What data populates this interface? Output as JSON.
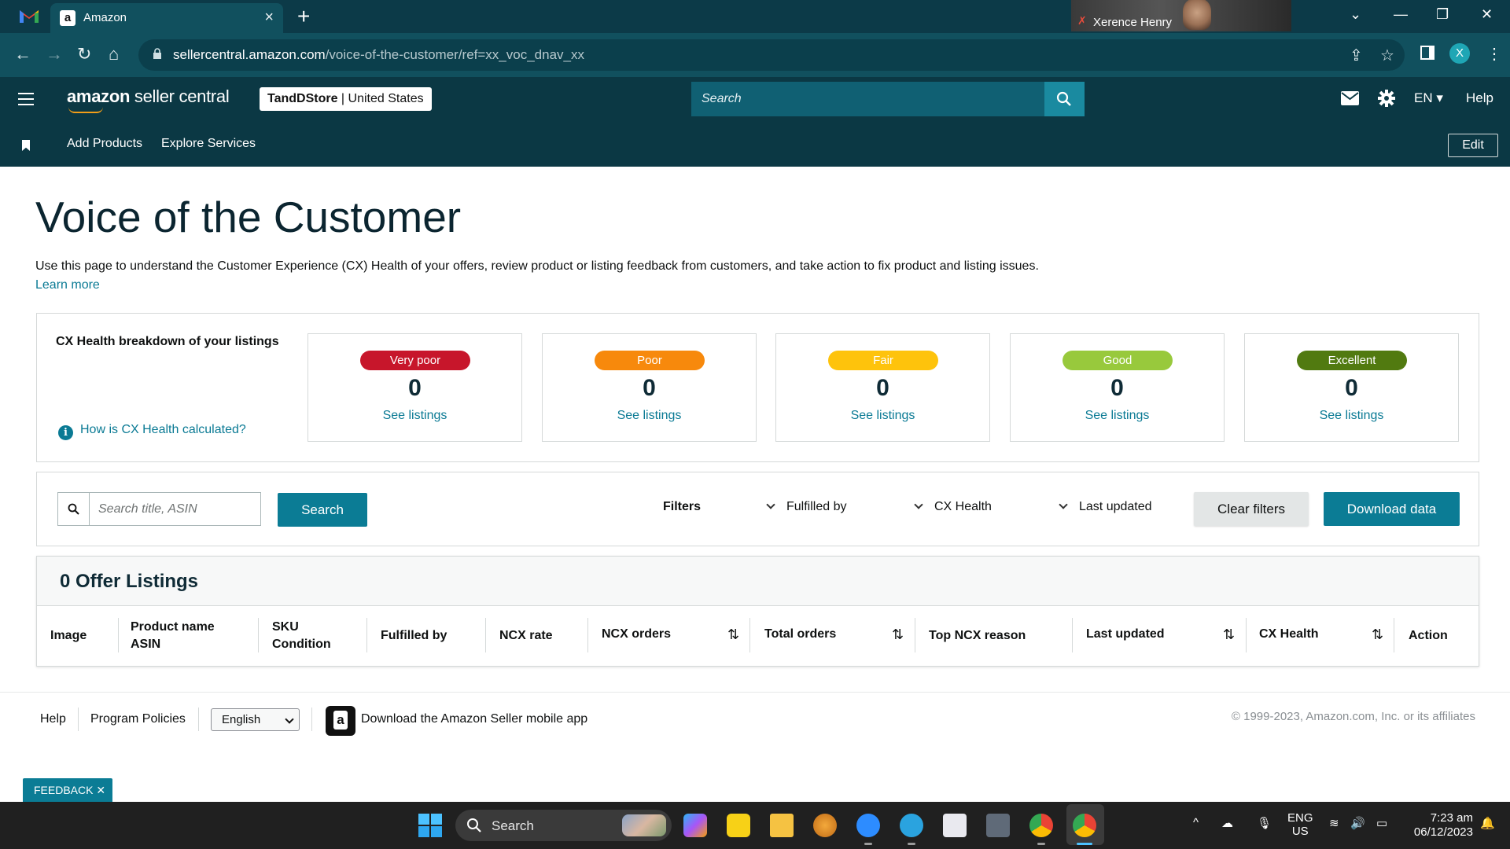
{
  "browser": {
    "tab_title": "Amazon",
    "url_domain": "sellercentral.amazon.com",
    "url_path": "/voice-of-the-customer/ref=xx_voc_dnav_xx",
    "profile_initial": "X",
    "meeting_participant": "Xerence Henry"
  },
  "header": {
    "logo_brand": "amazon",
    "logo_product": "seller central",
    "store_name": "TandDStore",
    "store_region": "United States",
    "search_placeholder": "Search",
    "language": "EN",
    "help": "Help"
  },
  "subnav": {
    "links": [
      "Add Products",
      "Explore Services"
    ],
    "edit": "Edit"
  },
  "page": {
    "title": "Voice of the Customer",
    "intro": "Use this page to understand the Customer Experience (CX) Health of your offers, review product or listing feedback from customers, and take action to fix product and listing issues.",
    "learn_more": "Learn more"
  },
  "breakdown": {
    "title": "CX Health breakdown of your listings",
    "info_link": "How is CX Health calculated?",
    "tiles": [
      {
        "label": "Very poor",
        "count": "0",
        "link": "See listings",
        "color": "#c7162b"
      },
      {
        "label": "Poor",
        "count": "0",
        "link": "See listings",
        "color": "#f7890c"
      },
      {
        "label": "Fair",
        "count": "0",
        "link": "See listings",
        "color": "#fec30c"
      },
      {
        "label": "Good",
        "count": "0",
        "link": "See listings",
        "color": "#98c93c"
      },
      {
        "label": "Excellent",
        "count": "0",
        "link": "See listings",
        "color": "#517a10"
      }
    ]
  },
  "filter_bar": {
    "search_placeholder": "Search title, ASIN",
    "search_button": "Search",
    "filters_label": "Filters",
    "filters": [
      "Fulfilled by",
      "CX Health",
      "Last updated"
    ],
    "clear_filters": "Clear filters",
    "download": "Download data"
  },
  "listings": {
    "title": "0 Offer Listings",
    "columns": {
      "image": "Image",
      "product_name": "Product name",
      "asin": "ASIN",
      "sku": "SKU",
      "condition": "Condition",
      "fulfilled_by": "Fulfilled by",
      "ncx_rate": "NCX rate",
      "ncx_orders": "NCX orders",
      "total_orders": "Total orders",
      "top_ncx_reason": "Top NCX reason",
      "last_updated": "Last updated",
      "cx_health": "CX Health",
      "action": "Action"
    }
  },
  "footer": {
    "help": "Help",
    "program_policies": "Program Policies",
    "language_selected": "English",
    "app_text": "Download the Amazon Seller mobile app",
    "copyright": "© 1999-2023, Amazon.com, Inc. or its affiliates"
  },
  "feedback": "FEEDBACK ✕",
  "taskbar": {
    "search": "Search",
    "lang_top": "ENG",
    "lang_bottom": "US",
    "time": "7:23 am",
    "date": "06/12/2023"
  },
  "colors": {
    "header_bg": "#0b3844",
    "accent": "#0b7c95",
    "link": "#0a7a94"
  }
}
